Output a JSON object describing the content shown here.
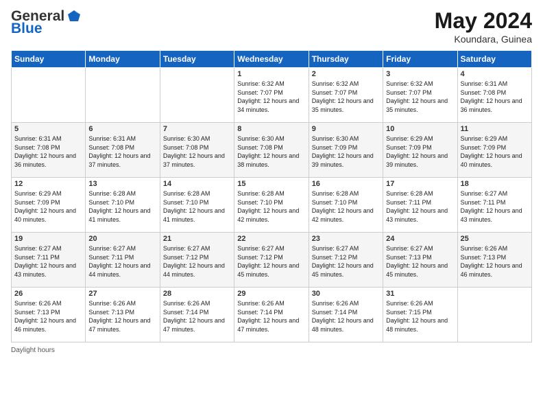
{
  "header": {
    "logo_general": "General",
    "logo_blue": "Blue",
    "title": "May 2024",
    "location": "Koundara, Guinea"
  },
  "days_of_week": [
    "Sunday",
    "Monday",
    "Tuesday",
    "Wednesday",
    "Thursday",
    "Friday",
    "Saturday"
  ],
  "weeks": [
    [
      {
        "day": "",
        "sunrise": "",
        "sunset": "",
        "daylight": ""
      },
      {
        "day": "",
        "sunrise": "",
        "sunset": "",
        "daylight": ""
      },
      {
        "day": "",
        "sunrise": "",
        "sunset": "",
        "daylight": ""
      },
      {
        "day": "1",
        "sunrise": "Sunrise: 6:32 AM",
        "sunset": "Sunset: 7:07 PM",
        "daylight": "Daylight: 12 hours and 34 minutes."
      },
      {
        "day": "2",
        "sunrise": "Sunrise: 6:32 AM",
        "sunset": "Sunset: 7:07 PM",
        "daylight": "Daylight: 12 hours and 35 minutes."
      },
      {
        "day": "3",
        "sunrise": "Sunrise: 6:32 AM",
        "sunset": "Sunset: 7:07 PM",
        "daylight": "Daylight: 12 hours and 35 minutes."
      },
      {
        "day": "4",
        "sunrise": "Sunrise: 6:31 AM",
        "sunset": "Sunset: 7:08 PM",
        "daylight": "Daylight: 12 hours and 36 minutes."
      }
    ],
    [
      {
        "day": "5",
        "sunrise": "Sunrise: 6:31 AM",
        "sunset": "Sunset: 7:08 PM",
        "daylight": "Daylight: 12 hours and 36 minutes."
      },
      {
        "day": "6",
        "sunrise": "Sunrise: 6:31 AM",
        "sunset": "Sunset: 7:08 PM",
        "daylight": "Daylight: 12 hours and 37 minutes."
      },
      {
        "day": "7",
        "sunrise": "Sunrise: 6:30 AM",
        "sunset": "Sunset: 7:08 PM",
        "daylight": "Daylight: 12 hours and 37 minutes."
      },
      {
        "day": "8",
        "sunrise": "Sunrise: 6:30 AM",
        "sunset": "Sunset: 7:08 PM",
        "daylight": "Daylight: 12 hours and 38 minutes."
      },
      {
        "day": "9",
        "sunrise": "Sunrise: 6:30 AM",
        "sunset": "Sunset: 7:09 PM",
        "daylight": "Daylight: 12 hours and 39 minutes."
      },
      {
        "day": "10",
        "sunrise": "Sunrise: 6:29 AM",
        "sunset": "Sunset: 7:09 PM",
        "daylight": "Daylight: 12 hours and 39 minutes."
      },
      {
        "day": "11",
        "sunrise": "Sunrise: 6:29 AM",
        "sunset": "Sunset: 7:09 PM",
        "daylight": "Daylight: 12 hours and 40 minutes."
      }
    ],
    [
      {
        "day": "12",
        "sunrise": "Sunrise: 6:29 AM",
        "sunset": "Sunset: 7:09 PM",
        "daylight": "Daylight: 12 hours and 40 minutes."
      },
      {
        "day": "13",
        "sunrise": "Sunrise: 6:28 AM",
        "sunset": "Sunset: 7:10 PM",
        "daylight": "Daylight: 12 hours and 41 minutes."
      },
      {
        "day": "14",
        "sunrise": "Sunrise: 6:28 AM",
        "sunset": "Sunset: 7:10 PM",
        "daylight": "Daylight: 12 hours and 41 minutes."
      },
      {
        "day": "15",
        "sunrise": "Sunrise: 6:28 AM",
        "sunset": "Sunset: 7:10 PM",
        "daylight": "Daylight: 12 hours and 42 minutes."
      },
      {
        "day": "16",
        "sunrise": "Sunrise: 6:28 AM",
        "sunset": "Sunset: 7:10 PM",
        "daylight": "Daylight: 12 hours and 42 minutes."
      },
      {
        "day": "17",
        "sunrise": "Sunrise: 6:28 AM",
        "sunset": "Sunset: 7:11 PM",
        "daylight": "Daylight: 12 hours and 43 minutes."
      },
      {
        "day": "18",
        "sunrise": "Sunrise: 6:27 AM",
        "sunset": "Sunset: 7:11 PM",
        "daylight": "Daylight: 12 hours and 43 minutes."
      }
    ],
    [
      {
        "day": "19",
        "sunrise": "Sunrise: 6:27 AM",
        "sunset": "Sunset: 7:11 PM",
        "daylight": "Daylight: 12 hours and 43 minutes."
      },
      {
        "day": "20",
        "sunrise": "Sunrise: 6:27 AM",
        "sunset": "Sunset: 7:11 PM",
        "daylight": "Daylight: 12 hours and 44 minutes."
      },
      {
        "day": "21",
        "sunrise": "Sunrise: 6:27 AM",
        "sunset": "Sunset: 7:12 PM",
        "daylight": "Daylight: 12 hours and 44 minutes."
      },
      {
        "day": "22",
        "sunrise": "Sunrise: 6:27 AM",
        "sunset": "Sunset: 7:12 PM",
        "daylight": "Daylight: 12 hours and 45 minutes."
      },
      {
        "day": "23",
        "sunrise": "Sunrise: 6:27 AM",
        "sunset": "Sunset: 7:12 PM",
        "daylight": "Daylight: 12 hours and 45 minutes."
      },
      {
        "day": "24",
        "sunrise": "Sunrise: 6:27 AM",
        "sunset": "Sunset: 7:13 PM",
        "daylight": "Daylight: 12 hours and 45 minutes."
      },
      {
        "day": "25",
        "sunrise": "Sunrise: 6:26 AM",
        "sunset": "Sunset: 7:13 PM",
        "daylight": "Daylight: 12 hours and 46 minutes."
      }
    ],
    [
      {
        "day": "26",
        "sunrise": "Sunrise: 6:26 AM",
        "sunset": "Sunset: 7:13 PM",
        "daylight": "Daylight: 12 hours and 46 minutes."
      },
      {
        "day": "27",
        "sunrise": "Sunrise: 6:26 AM",
        "sunset": "Sunset: 7:13 PM",
        "daylight": "Daylight: 12 hours and 47 minutes."
      },
      {
        "day": "28",
        "sunrise": "Sunrise: 6:26 AM",
        "sunset": "Sunset: 7:14 PM",
        "daylight": "Daylight: 12 hours and 47 minutes."
      },
      {
        "day": "29",
        "sunrise": "Sunrise: 6:26 AM",
        "sunset": "Sunset: 7:14 PM",
        "daylight": "Daylight: 12 hours and 47 minutes."
      },
      {
        "day": "30",
        "sunrise": "Sunrise: 6:26 AM",
        "sunset": "Sunset: 7:14 PM",
        "daylight": "Daylight: 12 hours and 48 minutes."
      },
      {
        "day": "31",
        "sunrise": "Sunrise: 6:26 AM",
        "sunset": "Sunset: 7:15 PM",
        "daylight": "Daylight: 12 hours and 48 minutes."
      },
      {
        "day": "",
        "sunrise": "",
        "sunset": "",
        "daylight": ""
      }
    ]
  ],
  "footer": {
    "daylight_label": "Daylight hours"
  }
}
